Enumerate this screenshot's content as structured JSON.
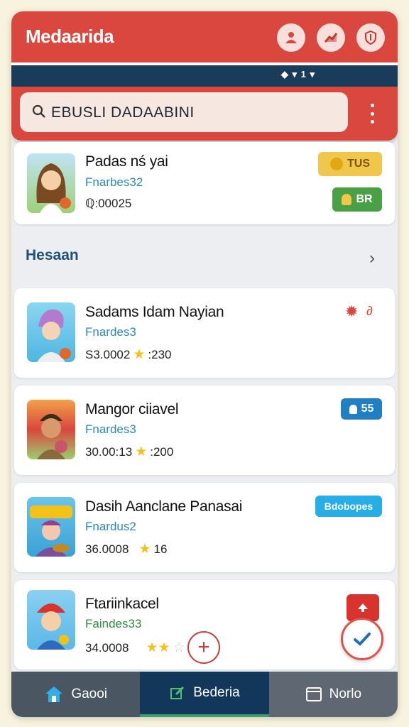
{
  "app": {
    "title": "Medaarida"
  },
  "header": {
    "icons": [
      "user-icon",
      "chart-icon",
      "shield-icon"
    ],
    "accent": "#d9473f"
  },
  "statusbar": {
    "text": "◆ ▾ 1 ▾"
  },
  "search": {
    "value": "EBUSLI DADAABINI"
  },
  "featured": {
    "name": "Padas nś yai",
    "sub": "Fnarbes32",
    "meta": "ℚ:00025",
    "badge1": "TUS",
    "badge2": "BR"
  },
  "section": {
    "title": "Hesaan"
  },
  "list": [
    {
      "name": "Sadams Idam Nayian",
      "sub": "Fnardes3",
      "meta": "S3.0002",
      "rating": ":230"
    },
    {
      "name": "Mangor ciiavel",
      "sub": "Fnardes3",
      "meta": "30.00:13",
      "rating": ":200",
      "badge": "55"
    },
    {
      "name": "Dasih Aanclane Panasai",
      "sub": "Fnardus2",
      "meta": "36.0008",
      "rating": "16",
      "badge": "Bdobopes"
    },
    {
      "name": "Ftariinkacel",
      "sub": "Faindes33",
      "meta": "34.0008"
    }
  ],
  "nav": {
    "home": "Gaooi",
    "active": "Bederia",
    "notes": "Norlo"
  }
}
